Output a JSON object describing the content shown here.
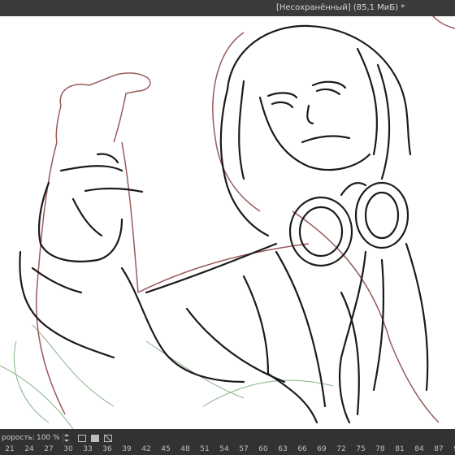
{
  "window": {
    "title": "[Несохранённый]  (85,1 МиБ) *"
  },
  "timeline": {
    "opacity_label": "рорость:",
    "opacity_value": "100 %",
    "frame_numbers": [
      "21",
      "24",
      "27",
      "30",
      "33",
      "36",
      "39",
      "42",
      "45",
      "48",
      "51",
      "54",
      "57",
      "60",
      "63",
      "66",
      "69",
      "72",
      "75",
      "78",
      "81",
      "84",
      "87",
      "90"
    ]
  },
  "colors": {
    "canvas": "#ffffff",
    "ink": "#1b1b1b",
    "sketch_red": "#9a5a5a",
    "sketch_green": "#6aa06a",
    "panel": "#323232"
  }
}
